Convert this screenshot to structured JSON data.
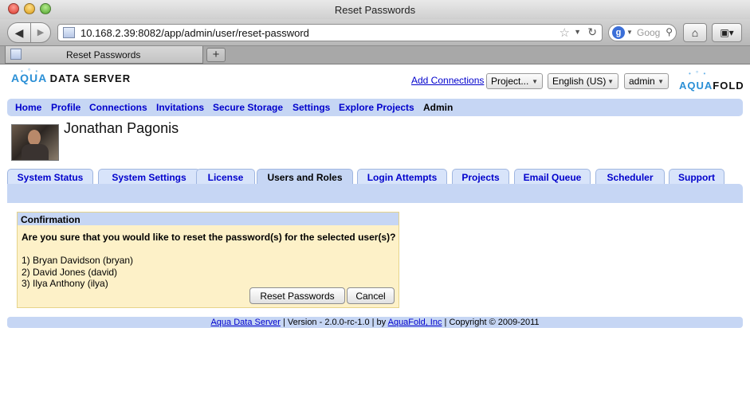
{
  "browser": {
    "window_title": "Reset Passwords",
    "url": "10.168.2.39:8082/app/admin/user/reset-password",
    "search_placeholder": "Goog",
    "tab_title": "Reset Passwords",
    "new_tab_label": "+"
  },
  "header": {
    "brand_left_aqua": "AQUA",
    "brand_left_rest": "DATA SERVER",
    "add_connections": "Add Connections",
    "project_select": "Project...",
    "language_select": "English (US)",
    "user_select": "admin",
    "brand_right_aqua": "AQUA",
    "brand_right_rest": "FOLD"
  },
  "mainnav": {
    "items": [
      "Home",
      "Profile",
      "Connections",
      "Invitations",
      "Secure Storage",
      "Settings",
      "Explore Projects",
      "Admin"
    ],
    "current": "Admin"
  },
  "user": {
    "name": "Jonathan Pagonis"
  },
  "admin_tabs": {
    "items": [
      "System Status",
      "System Settings",
      "License",
      "Users and Roles",
      "Login Attempts",
      "Projects",
      "Email Queue",
      "Scheduler",
      "Support"
    ],
    "active": "Users and Roles"
  },
  "confirmation": {
    "heading": "Confirmation",
    "question": "Are you sure that you would like to reset the password(s) for the selected user(s)?",
    "users": [
      "1) Bryan Davidson (bryan)",
      "2) David Jones (david)",
      "3) Ilya Anthony (ilya)"
    ],
    "reset_label": "Reset Passwords",
    "cancel_label": "Cancel"
  },
  "footer": {
    "product_link": "Aqua Data Server",
    "version_text": " | Version - 2.0.0-rc-1.0 | by ",
    "company_link": "AquaFold, Inc",
    "copyright_text": " | Copyright © 2009-2011"
  },
  "icons": {
    "back": "back-arrow-icon",
    "forward": "forward-arrow-icon",
    "home": "home-icon",
    "bookmarks": "bookmarks-icon",
    "reload": "reload-icon",
    "star": "star-icon"
  }
}
